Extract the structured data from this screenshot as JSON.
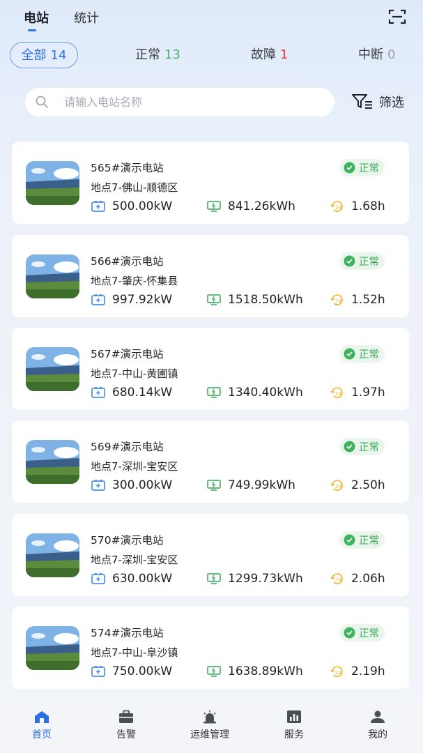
{
  "top_tabs": [
    {
      "label": "电站",
      "active": true
    },
    {
      "label": "统计",
      "active": false
    }
  ],
  "header_icons": {
    "scan": "scan-icon"
  },
  "status_filters": {
    "all": {
      "label": "全部",
      "count": "14",
      "selected": true
    },
    "normal": {
      "label": "正常",
      "count": "13",
      "color": "#4bb26b"
    },
    "fault": {
      "label": "故障",
      "count": "1",
      "color": "#e23a3a"
    },
    "interrupted": {
      "label": "中断",
      "count": "0",
      "color": "#9aa0a8"
    }
  },
  "search": {
    "placeholder": "请输入电站名称",
    "value": ""
  },
  "filter_button": {
    "label": "筛选"
  },
  "stations": [
    {
      "name": "565#演示电站",
      "location": "地点7-佛山-顺德区",
      "status": "正常",
      "capacity": "500.00kW",
      "energy": "841.26kWh",
      "hours": "1.68h"
    },
    {
      "name": "566#演示电站",
      "location": "地点7-肇庆-怀集县",
      "status": "正常",
      "capacity": "997.92kW",
      "energy": "1518.50kWh",
      "hours": "1.52h"
    },
    {
      "name": "567#演示电站",
      "location": "地点7-中山-黄圃镇",
      "status": "正常",
      "capacity": "680.14kW",
      "energy": "1340.40kWh",
      "hours": "1.97h"
    },
    {
      "name": "569#演示电站",
      "location": "地点7-深圳-宝安区",
      "status": "正常",
      "capacity": "300.00kW",
      "energy": "749.99kWh",
      "hours": "2.50h"
    },
    {
      "name": "570#演示电站",
      "location": "地点7-深圳-宝安区",
      "status": "正常",
      "capacity": "630.00kW",
      "energy": "1299.73kWh",
      "hours": "2.06h"
    },
    {
      "name": "574#演示电站",
      "location": "地点7-中山-阜沙镇",
      "status": "正常",
      "capacity": "750.00kW",
      "energy": "1638.89kWh",
      "hours": "2.19h"
    }
  ],
  "bottom_nav": [
    {
      "label": "首页",
      "icon": "home-icon",
      "active": true
    },
    {
      "label": "告警",
      "icon": "alarm-toolbox-icon",
      "active": false
    },
    {
      "label": "运维管理",
      "icon": "siren-icon",
      "active": false
    },
    {
      "label": "服务",
      "icon": "bar-chart-icon",
      "active": false
    },
    {
      "label": "我的",
      "icon": "user-icon",
      "active": false
    }
  ],
  "colors": {
    "accent": "#2f6fe4",
    "normal_green": "#3aa75a",
    "capacity_blue": "#4a8fe6",
    "energy_green": "#4bb26b",
    "hours_orange": "#f2b53a"
  }
}
